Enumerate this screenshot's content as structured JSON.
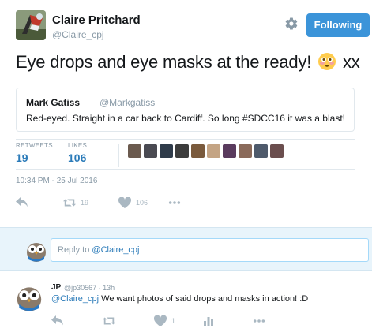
{
  "tweet": {
    "author_name": "Claire Pritchard",
    "author_handle": "@Claire_cpj",
    "follow_label": "Following",
    "text_before": "Eye drops and eye masks at the ready! ",
    "text_after": " xx",
    "emoji_icon": "flushed-face-icon",
    "quote": {
      "name": "Mark Gatiss",
      "handle": "@Markgatiss",
      "text": "Red-eyed. Straight in a car back to Cardiff. So long #SDCC16 it was a blast!"
    },
    "stats": {
      "retweets_label": "RETWEETS",
      "retweets_value": "19",
      "likes_label": "LIKES",
      "likes_value": "106"
    },
    "timestamp": "10:34 PM - 25 Jul 2016",
    "actions": {
      "retweet_count": "19",
      "like_count": "106"
    }
  },
  "reply_box": {
    "prefix": "Reply to ",
    "mention": "@Claire_cpj"
  },
  "reply_tweet": {
    "name": "JP",
    "meta": "@jp30567 · 13h",
    "mention": "@Claire_cpj",
    "text": " We want photos of said drops and masks in action! :D",
    "like_count": "1"
  },
  "colors": {
    "accent": "#3b94d9",
    "link": "#2b7bb9",
    "muted": "#8899a6",
    "reply_bg": "#e8f4fb"
  }
}
